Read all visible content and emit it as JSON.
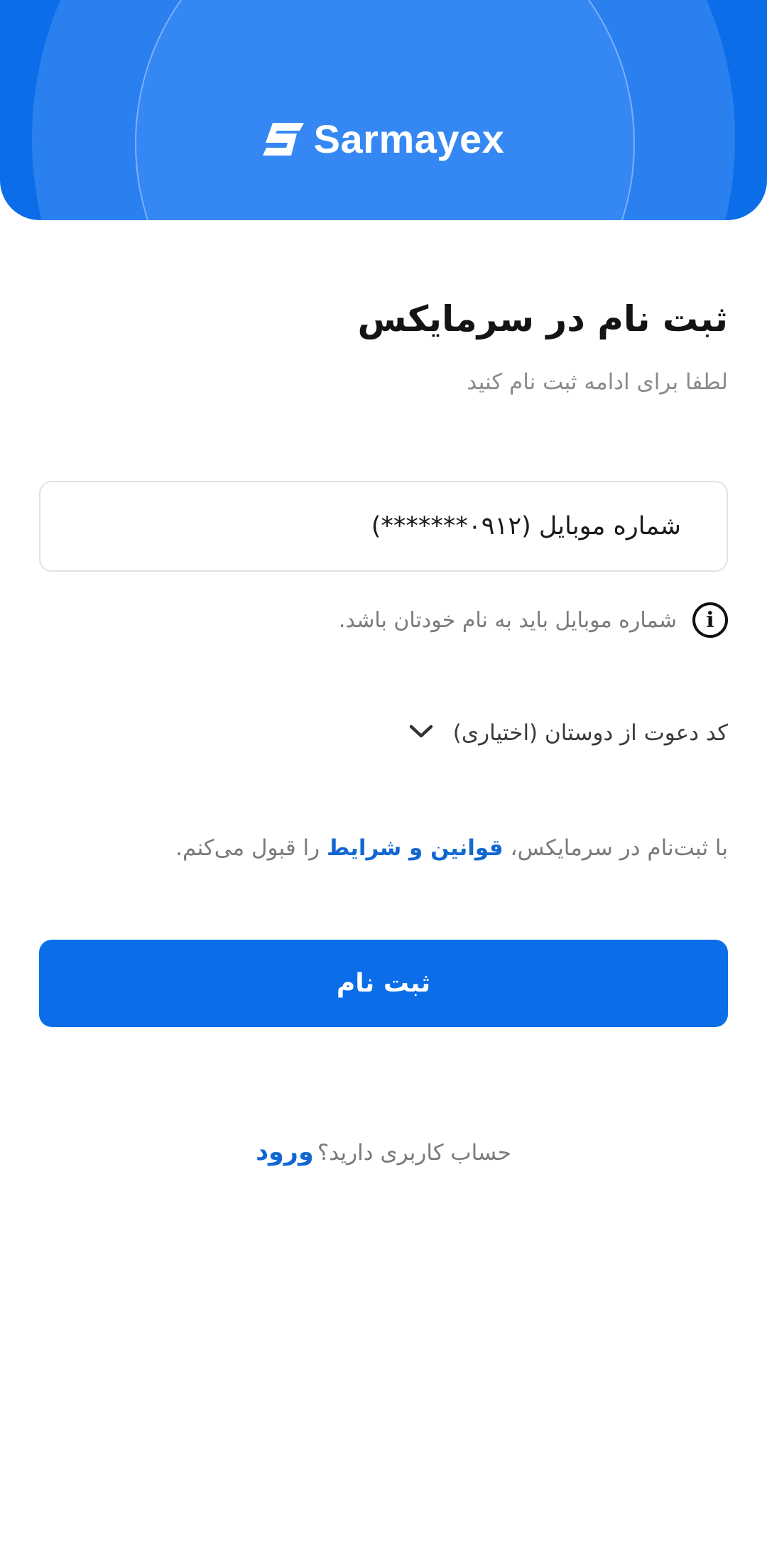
{
  "header": {
    "brand_name": "Sarmayex",
    "logo_icon": "sarmayex-logo-icon"
  },
  "form": {
    "title": "ثبت نام در سرمایکس",
    "subtitle": "لطفا برای ادامه ثبت نام کنید",
    "phone_field": {
      "placeholder": "شماره موبایل (۰۹۱۲*******)"
    },
    "hint": {
      "icon": "info-icon",
      "text": "شماره موبایل باید به نام خودتان باشد."
    },
    "invite": {
      "label": "کد دعوت از دوستان (اختیاری)",
      "icon": "chevron-down-icon"
    },
    "terms": {
      "before": "با ثبت‌نام در سرمایکس، ",
      "link": "قوانین و شرایط",
      "after": " را قبول می‌کنم."
    },
    "submit_label": "ثبت نام"
  },
  "footer": {
    "question": "حساب کاربری دارید؟",
    "login_label": "ورود"
  },
  "colors": {
    "primary": "#0b6ee8",
    "link": "#1267d0",
    "title": "#141414",
    "muted": "#7a7a7a",
    "border": "#e2e2e2"
  }
}
